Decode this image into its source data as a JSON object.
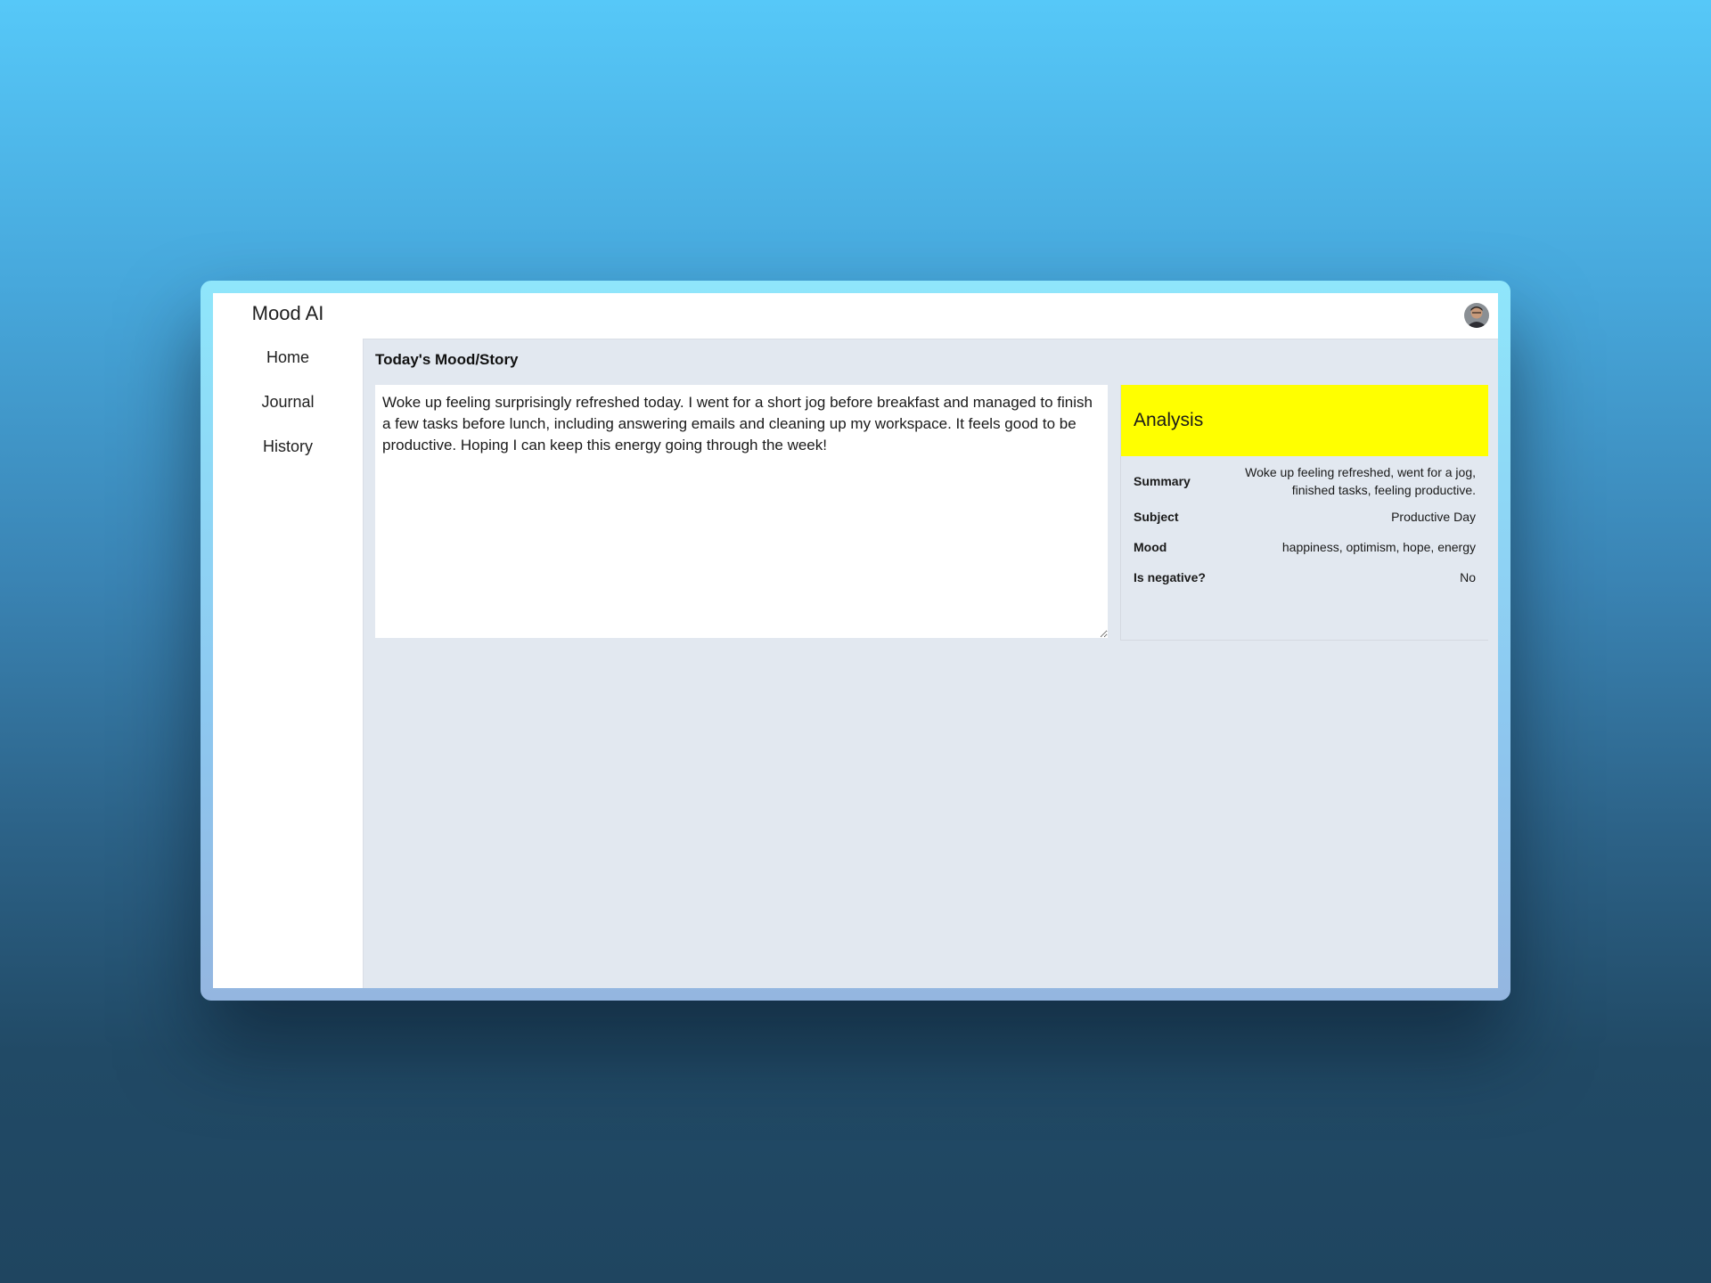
{
  "app": {
    "name": "Mood AI"
  },
  "sidebar": {
    "items": [
      {
        "label": "Home"
      },
      {
        "label": "Journal"
      },
      {
        "label": "History"
      }
    ]
  },
  "topbar": {
    "avatar_icon": "user-avatar"
  },
  "main": {
    "title": "Today's Mood/Story",
    "story_value": "Woke up feeling surprisingly refreshed today. I went for a short jog before breakfast and managed to finish a few tasks before lunch, including answering emails and cleaning up my workspace. It feels good to be productive. Hoping I can keep this energy going through the week!"
  },
  "analysis": {
    "title": "Analysis",
    "header_color": "#ffff00",
    "rows": [
      {
        "label": "Summary",
        "value": "Woke up feeling refreshed, went for a jog, finished tasks, feeling productive."
      },
      {
        "label": "Subject",
        "value": "Productive Day"
      },
      {
        "label": "Mood",
        "value": "happiness, optimism, hope, energy"
      },
      {
        "label": "Is negative?",
        "value": "No"
      }
    ]
  }
}
